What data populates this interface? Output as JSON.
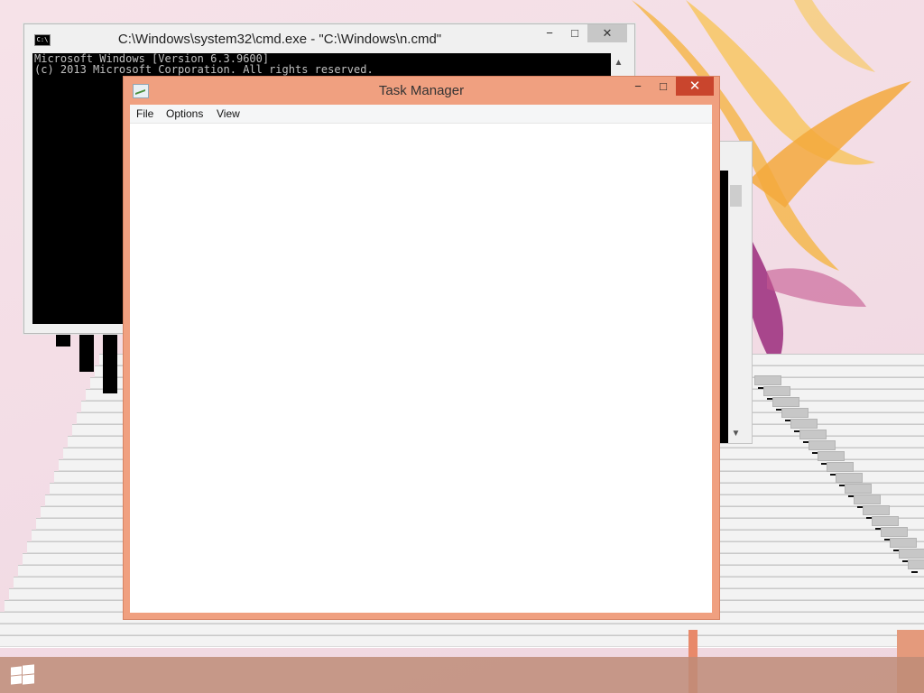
{
  "colors": {
    "task_manager_frame": "#f0a080",
    "close_button_red": "#c9452d",
    "console_bg": "#000000",
    "console_text": "#c0c0c0",
    "taskbar": "#be8c78"
  },
  "cmd_window": {
    "title": "C:\\Windows\\system32\\cmd.exe - \"C:\\Windows\\n.cmd\"",
    "icon": "console-icon",
    "console_lines": [
      "Microsoft Windows [Version 6.3.9600]",
      "(c) 2013 Microsoft Corporation. All rights reserved."
    ],
    "controls": {
      "minimize": "−",
      "maximize": "□",
      "close": "✕"
    },
    "scroll_up": "▲"
  },
  "task_manager": {
    "title": "Task Manager",
    "icon": "task-manager-icon",
    "menu": [
      "File",
      "Options",
      "View"
    ],
    "controls": {
      "minimize": "−",
      "maximize": "□",
      "close": "✕"
    }
  },
  "ghost_window_right": {
    "scroll_down": "▼"
  },
  "taskbar": {
    "start_icon": "windows-logo-icon"
  }
}
